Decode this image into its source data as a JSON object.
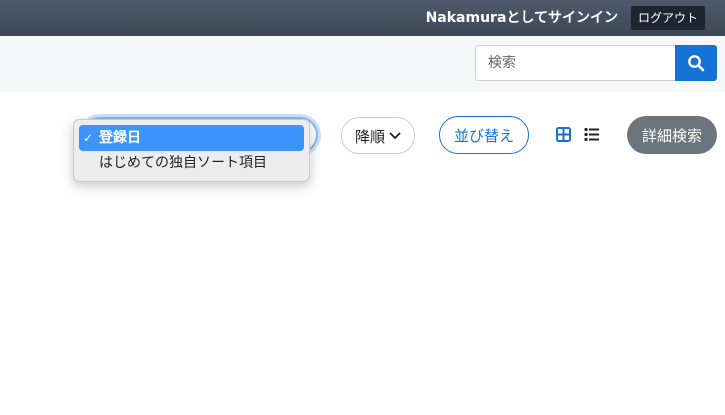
{
  "header": {
    "signin_text": "Nakamuraとしてサインイン",
    "logout_label": "ログアウト"
  },
  "search": {
    "placeholder": "検索",
    "button_icon": "search-icon"
  },
  "toolbar": {
    "sort_field": {
      "options": [
        {
          "label": "登録日",
          "selected": true
        },
        {
          "label": "はじめての独自ソート項目",
          "selected": false
        }
      ],
      "check_mark": "✓"
    },
    "order": {
      "label": "降順",
      "icon": "chevron-down-icon"
    },
    "sort_button_label": "並び替え",
    "view_icons": [
      "grid-view-icon",
      "list-view-icon"
    ],
    "advanced_search_label": "詳細検索"
  },
  "colors": {
    "header_bg": "#3d4856",
    "accent": "#1673d6",
    "selected_option": "#3c95ff",
    "advanced_button": "#6c757d"
  }
}
